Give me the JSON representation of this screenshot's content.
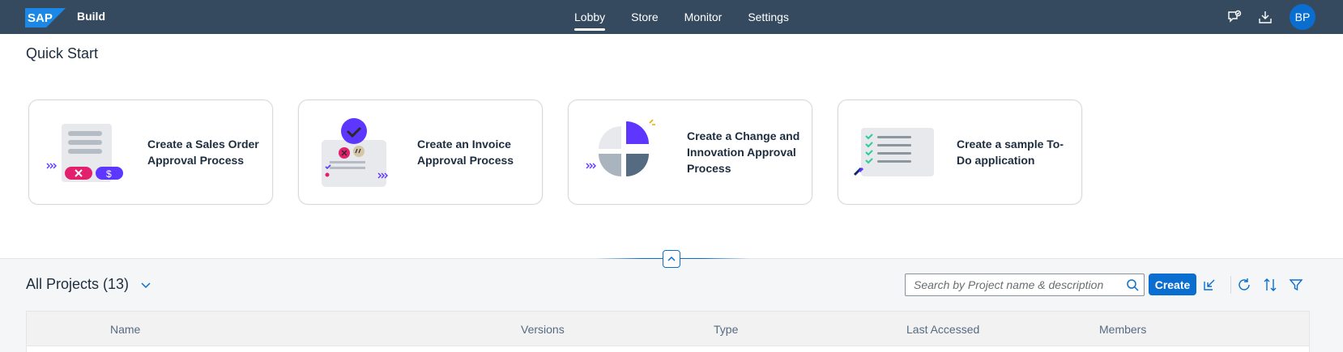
{
  "shell": {
    "brand": "SAP",
    "app_title": "Build",
    "nav": [
      {
        "label": "Lobby",
        "active": true
      },
      {
        "label": "Store",
        "active": false
      },
      {
        "label": "Monitor",
        "active": false
      },
      {
        "label": "Settings",
        "active": false
      }
    ],
    "avatar_initials": "BP",
    "icons": [
      "feedback-icon",
      "download-icon"
    ]
  },
  "quick_start": {
    "title": "Quick Start",
    "cards": [
      {
        "label": "Create a Sales Order Approval Process",
        "icon": "sales-order-illustration"
      },
      {
        "label": "Create an Invoice Approval Process",
        "icon": "invoice-illustration"
      },
      {
        "label": "Create a Change and Innovation Approval Process",
        "icon": "pie-chart-illustration"
      },
      {
        "label": "Create a sample To-Do application",
        "icon": "todo-list-illustration"
      }
    ]
  },
  "projects": {
    "title": "All Projects (13)",
    "search_placeholder": "Search by Project name & description",
    "create_label": "Create",
    "columns": [
      "Name",
      "Versions",
      "Type",
      "Last Accessed",
      "Members"
    ]
  },
  "colors": {
    "shell_bg": "#354a5f",
    "accent": "#0a6ed1",
    "purple": "#5d36ff",
    "pink": "#e3206d",
    "green": "#2ecc9a"
  }
}
